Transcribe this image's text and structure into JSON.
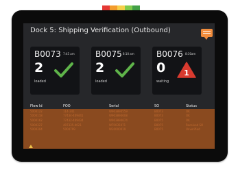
{
  "indicator": {
    "colors": [
      "#e53935",
      "#f39c2c",
      "#f6d04a",
      "#7fca4c",
      "#43a047"
    ]
  },
  "screen": {
    "title": "Dock 5: Shipping Verification (Outbound)",
    "chat_icon": "chat-icon"
  },
  "cards": [
    {
      "id": "B0073",
      "time": "7:45 am",
      "count": "2",
      "state": "loaded",
      "icon": "check-icon",
      "icon_color": "#5fb44a"
    },
    {
      "id": "B0075",
      "time": "8:10 am",
      "count": "2",
      "state": "loaded",
      "icon": "check-icon",
      "icon_color": "#5fb44a"
    },
    {
      "id": "B0076",
      "time": "8:30am",
      "count": "0",
      "state": "waiting",
      "icon": "alert-icon",
      "icon_color": "#d83a2f",
      "icon_text": "1"
    }
  ],
  "table": {
    "headers": [
      "Flow Id",
      "FOO",
      "Serial",
      "SO",
      "Status"
    ],
    "rows": [
      [
        "5000122",
        "114-241",
        "W903894559",
        "B0073",
        "OK"
      ],
      [
        "5000118",
        "77434-409441",
        "W903894608",
        "B0073",
        "OK"
      ],
      [
        "5000162",
        "77432-409434",
        "W903894674",
        "B0075",
        "OK"
      ],
      [
        "5000327",
        "407335-4021",
        "WT0035071",
        "B0075",
        "Received SO"
      ],
      [
        "5000304",
        "5004799",
        "W30000019",
        "B0075",
        "Unverified"
      ]
    ]
  },
  "colors": {
    "bezel": "#0b0b0b",
    "screen": "#26272a",
    "table_bg": "#8a4a1f",
    "accent": "#f08c3c"
  }
}
